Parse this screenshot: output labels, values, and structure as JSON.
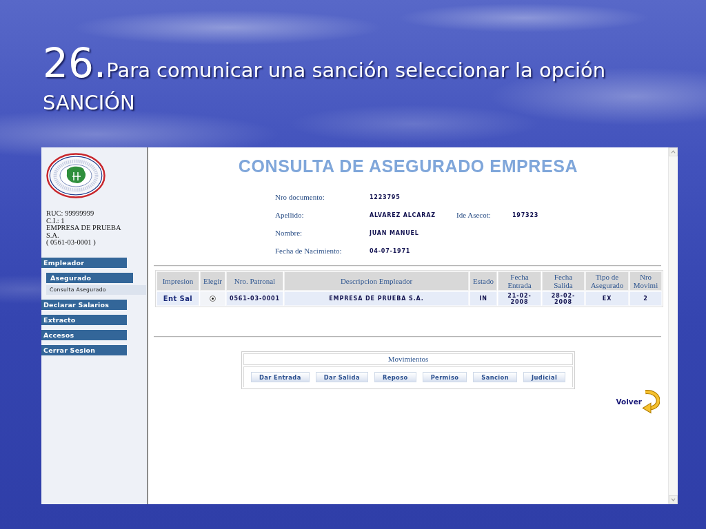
{
  "slide": {
    "number": "26.",
    "title": "Para comunicar una sanción seleccionar la opción SANCIÓN"
  },
  "sidebar": {
    "employer_info": {
      "ruc": "RUC: 99999999",
      "ci": "C.I.: 1",
      "company": "EMPRESA DE PRUEBA S.A.",
      "patronal": "( 0561-03-0001 )"
    },
    "menu": [
      {
        "label": "Empleador",
        "children": [
          {
            "label": "Asegurado",
            "children": [
              {
                "label": "Consulta Asegurado"
              }
            ]
          }
        ]
      },
      {
        "label": "Declarar Salarios"
      },
      {
        "label": "Extracto"
      },
      {
        "label": "Accesos"
      },
      {
        "label": "Cerrar Sesion"
      }
    ]
  },
  "main": {
    "title": "CONSULTA DE ASEGURADO EMPRESA",
    "fields": [
      [
        {
          "label": "Nro documento:",
          "value": "1223795"
        }
      ],
      [
        {
          "label": "Apellido:",
          "value": "ALVAREZ ALCARAZ"
        },
        {
          "label": "Ide Asecot:",
          "value": "197323"
        }
      ],
      [
        {
          "label": "Nombre:",
          "value": "JUAN MANUEL"
        }
      ],
      [
        {
          "label": "Fecha de Nacimiento:",
          "value": "04-07-1971"
        }
      ]
    ],
    "table": {
      "columns": [
        "Impresion",
        "Elegir",
        "Nro. Patronal",
        "Descripcion Empleador",
        "Estado",
        "Fecha Entrada",
        "Fecha Salida",
        "Tipo de Asegurado",
        "Nro Movimi"
      ],
      "rows": [
        {
          "selected": true,
          "cells": [
            {
              "kind": "link",
              "text": "Ent Sal"
            },
            {
              "kind": "radio"
            },
            {
              "kind": "text",
              "text": "0561-03-0001"
            },
            {
              "kind": "text",
              "text": "EMPRESA DE PRUEBA S.A."
            },
            {
              "kind": "text",
              "text": "IN"
            },
            {
              "kind": "text",
              "text": "21-02-2008"
            },
            {
              "kind": "text",
              "text": "28-02-2008"
            },
            {
              "kind": "text",
              "text": "EX"
            },
            {
              "kind": "text",
              "text": "2"
            }
          ]
        }
      ]
    },
    "movements": {
      "title": "Movimientos",
      "buttons": [
        "Dar Entrada",
        "Dar Salida",
        "Reposo",
        "Permiso",
        "Sancion",
        "Judicial"
      ]
    },
    "back_link": "Volver"
  }
}
